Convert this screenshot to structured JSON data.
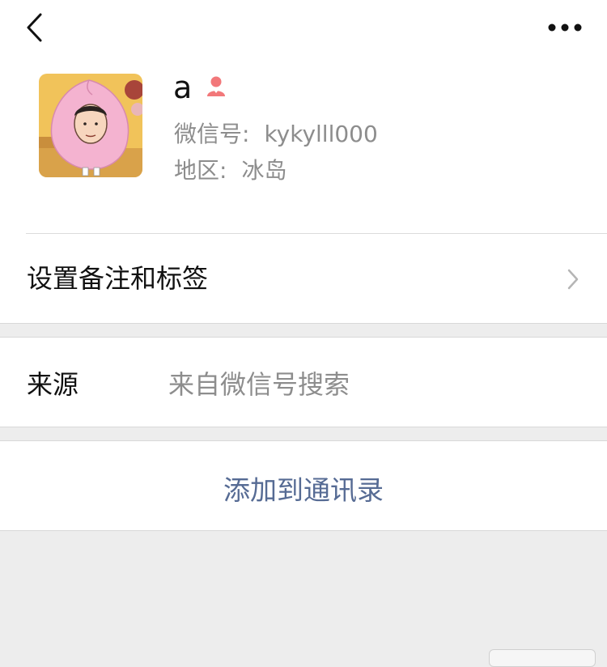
{
  "nav": {
    "back_icon": "chevron-left-icon",
    "more_icon": "more-horizontal-icon"
  },
  "profile": {
    "name": "a",
    "gender_icon": "female-person-icon",
    "gender_color": "#f2787a",
    "wechat_id_label": "微信号:",
    "wechat_id_value": "kykylll000",
    "region_label": "地区:",
    "region_value": "冰岛"
  },
  "rows": {
    "remark_label": "设置备注和标签",
    "source_label": "来源",
    "source_value": "来自微信号搜索"
  },
  "actions": {
    "add_contact": "添加到通讯录",
    "accent_color": "#566b94"
  }
}
